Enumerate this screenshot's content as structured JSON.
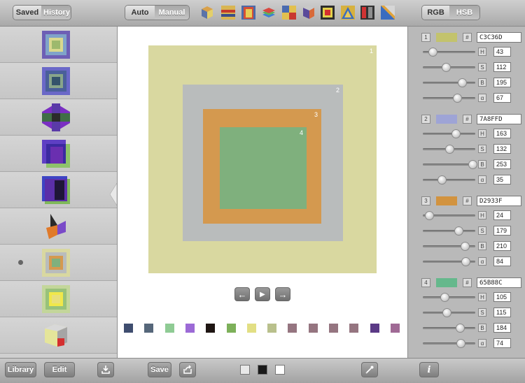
{
  "left_panel": {
    "tabs": [
      {
        "label": "Saved",
        "active": false
      },
      {
        "label": "History",
        "active": true
      }
    ],
    "history_count": 9,
    "selected_index": 6
  },
  "center": {
    "mode_tabs": [
      {
        "label": "Auto",
        "active": false
      },
      {
        "label": "Manual",
        "active": true
      }
    ],
    "square_labels": [
      "1",
      "2",
      "3",
      "4"
    ],
    "square_colors": [
      "#d9d8a0",
      "#b9bcbc",
      "#d4994f",
      "#7fb07d"
    ],
    "nav": {
      "prev_icon": "arrow-left-icon",
      "play_icon": "play-icon",
      "next_icon": "arrow-right-icon"
    },
    "palette": [
      "#3f4d6f",
      "#56677a",
      "#8fcb94",
      "#9c6ad6",
      "#1f1613",
      "#7db05a",
      "#e2df84",
      "#b9c08c",
      "#957580",
      "#957580",
      "#957580",
      "#957580",
      "#5b3a86",
      "#a06a95"
    ]
  },
  "toolbar": {
    "save_label": "Save",
    "library_label": "Library",
    "edit_label": "Edit",
    "share_icon": "share-icon",
    "import_icon": "import-icon",
    "eyedropper_icon": "eyedropper-icon",
    "backgrounds": [
      "#e8e8e8",
      "#1a1a1a",
      "#ffffff"
    ]
  },
  "right_panel": {
    "mode_tabs": [
      {
        "label": "RGB",
        "active": false
      },
      {
        "label": "HSB",
        "active": true
      }
    ],
    "colors": [
      {
        "index": "1",
        "hex": "C3C36D",
        "swatch": "#c3c36d",
        "H": 43,
        "S": 112,
        "B": 195,
        "alpha": 67
      },
      {
        "index": "2",
        "hex": "7A8FFD",
        "swatch": "#9ea4d6",
        "H": 163,
        "S": 132,
        "B": 253,
        "alpha": 35
      },
      {
        "index": "3",
        "hex": "D2933F",
        "swatch": "#d2933f",
        "H": 24,
        "S": 179,
        "B": 210,
        "alpha": 84
      },
      {
        "index": "4",
        "hex": "65B88C",
        "swatch": "#65b88c",
        "H": 105,
        "S": 115,
        "B": 184,
        "alpha": 74
      }
    ],
    "channel_labels": [
      "H",
      "S",
      "B",
      "α"
    ],
    "hash_label": "#",
    "info_label": "i"
  }
}
